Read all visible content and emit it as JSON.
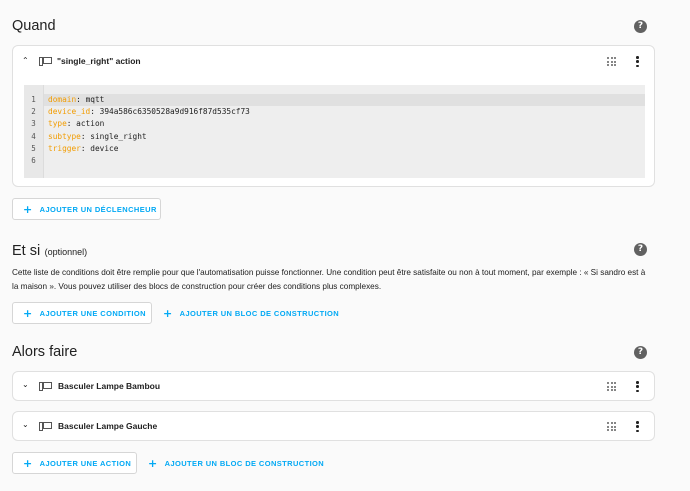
{
  "when": {
    "title": "Quand",
    "trigger": {
      "title": "\"single_right\" action",
      "code_lines": [
        {
          "num": "1",
          "key": "domain",
          "value": "mqtt"
        },
        {
          "num": "2",
          "key": "device_id",
          "value": "394a586c6350528a9d916f87d535cf73"
        },
        {
          "num": "3",
          "key": "type",
          "value": "action"
        },
        {
          "num": "4",
          "key": "subtype",
          "value": "single_right"
        },
        {
          "num": "5",
          "key": "trigger",
          "value": "device"
        },
        {
          "num": "6",
          "key": "",
          "value": ""
        }
      ]
    },
    "add_trigger_label": "AJOUTER UN DÉCLENCHEUR"
  },
  "conditions": {
    "title": "Et si",
    "optional": "(optionnel)",
    "description": "Cette liste de conditions doit être remplie pour que l'automatisation puisse fonctionner. Une condition peut être satisfaite ou non à tout moment, par exemple : « Si sandro est à la maison ». Vous pouvez utiliser des blocs de construction pour créer des conditions plus complexes.",
    "add_condition_label": "AJOUTER UNE CONDITION",
    "add_block_label": "AJOUTER UN BLOC DE CONSTRUCTION"
  },
  "actions": {
    "title": "Alors faire",
    "items": [
      {
        "title": "Basculer Lampe Bambou"
      },
      {
        "title": "Basculer Lampe Gauche"
      }
    ],
    "add_action_label": "AJOUTER UNE ACTION",
    "add_block_label": "AJOUTER UN BLOC DE CONSTRUCTION"
  },
  "icons": {
    "help": "help-circle-icon",
    "device": "device-icon",
    "drag": "drag-handle-icon",
    "menu": "overflow-menu-icon",
    "plus": "plus-icon",
    "expand": "chevron-icon"
  },
  "colors": {
    "accent": "#03a9f4",
    "yaml_key": "#f29c00",
    "background": "#fafafa"
  }
}
